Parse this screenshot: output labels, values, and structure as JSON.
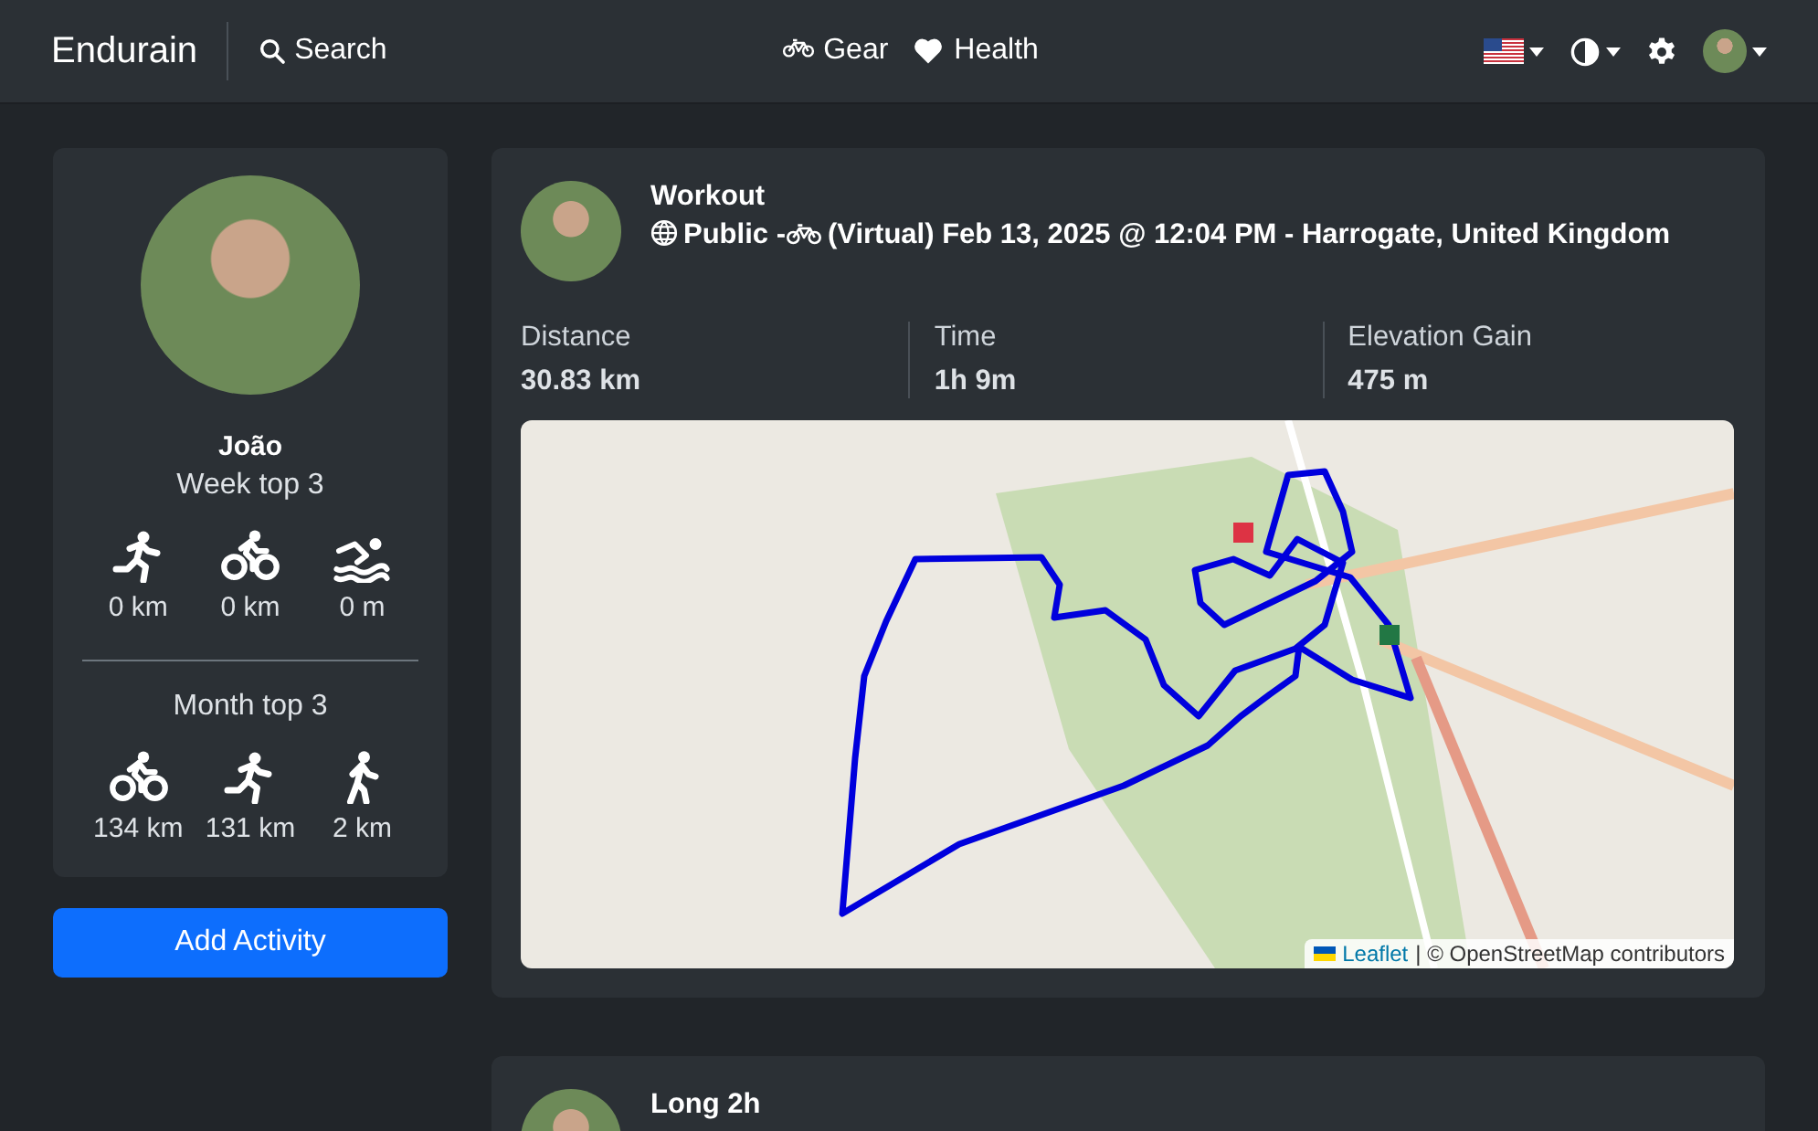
{
  "navbar": {
    "brand": "Endurain",
    "search": "Search",
    "links": [
      {
        "kind": "gear",
        "label": "Gear"
      },
      {
        "kind": "health",
        "label": "Health"
      }
    ]
  },
  "profile": {
    "name": "João",
    "week_title": "Week top 3",
    "week": [
      {
        "kind": "run",
        "value": "0 km"
      },
      {
        "kind": "ride",
        "value": "0 km"
      },
      {
        "kind": "swim",
        "value": "0 m"
      }
    ],
    "month_title": "Month top 3",
    "month": [
      {
        "kind": "ride",
        "value": "134 km"
      },
      {
        "kind": "run",
        "value": "131 km"
      },
      {
        "kind": "walk",
        "value": "2 km"
      }
    ]
  },
  "add_button": "Add Activity",
  "activities": [
    {
      "title": "Workout",
      "visibility": "Public -",
      "detail": "(Virtual) Feb 13, 2025 @ 12:04 PM - Harrogate, United Kingdom",
      "stats": [
        {
          "label": "Distance",
          "value": "30.83 km"
        },
        {
          "label": "Time",
          "value": "1h 9m"
        },
        {
          "label": "Elevation Gain",
          "value": "475 m"
        }
      ],
      "map": {
        "link": "Leaflet",
        "attribution": "| © OpenStreetMap contributors"
      }
    },
    {
      "title": "Long 2h"
    }
  ]
}
